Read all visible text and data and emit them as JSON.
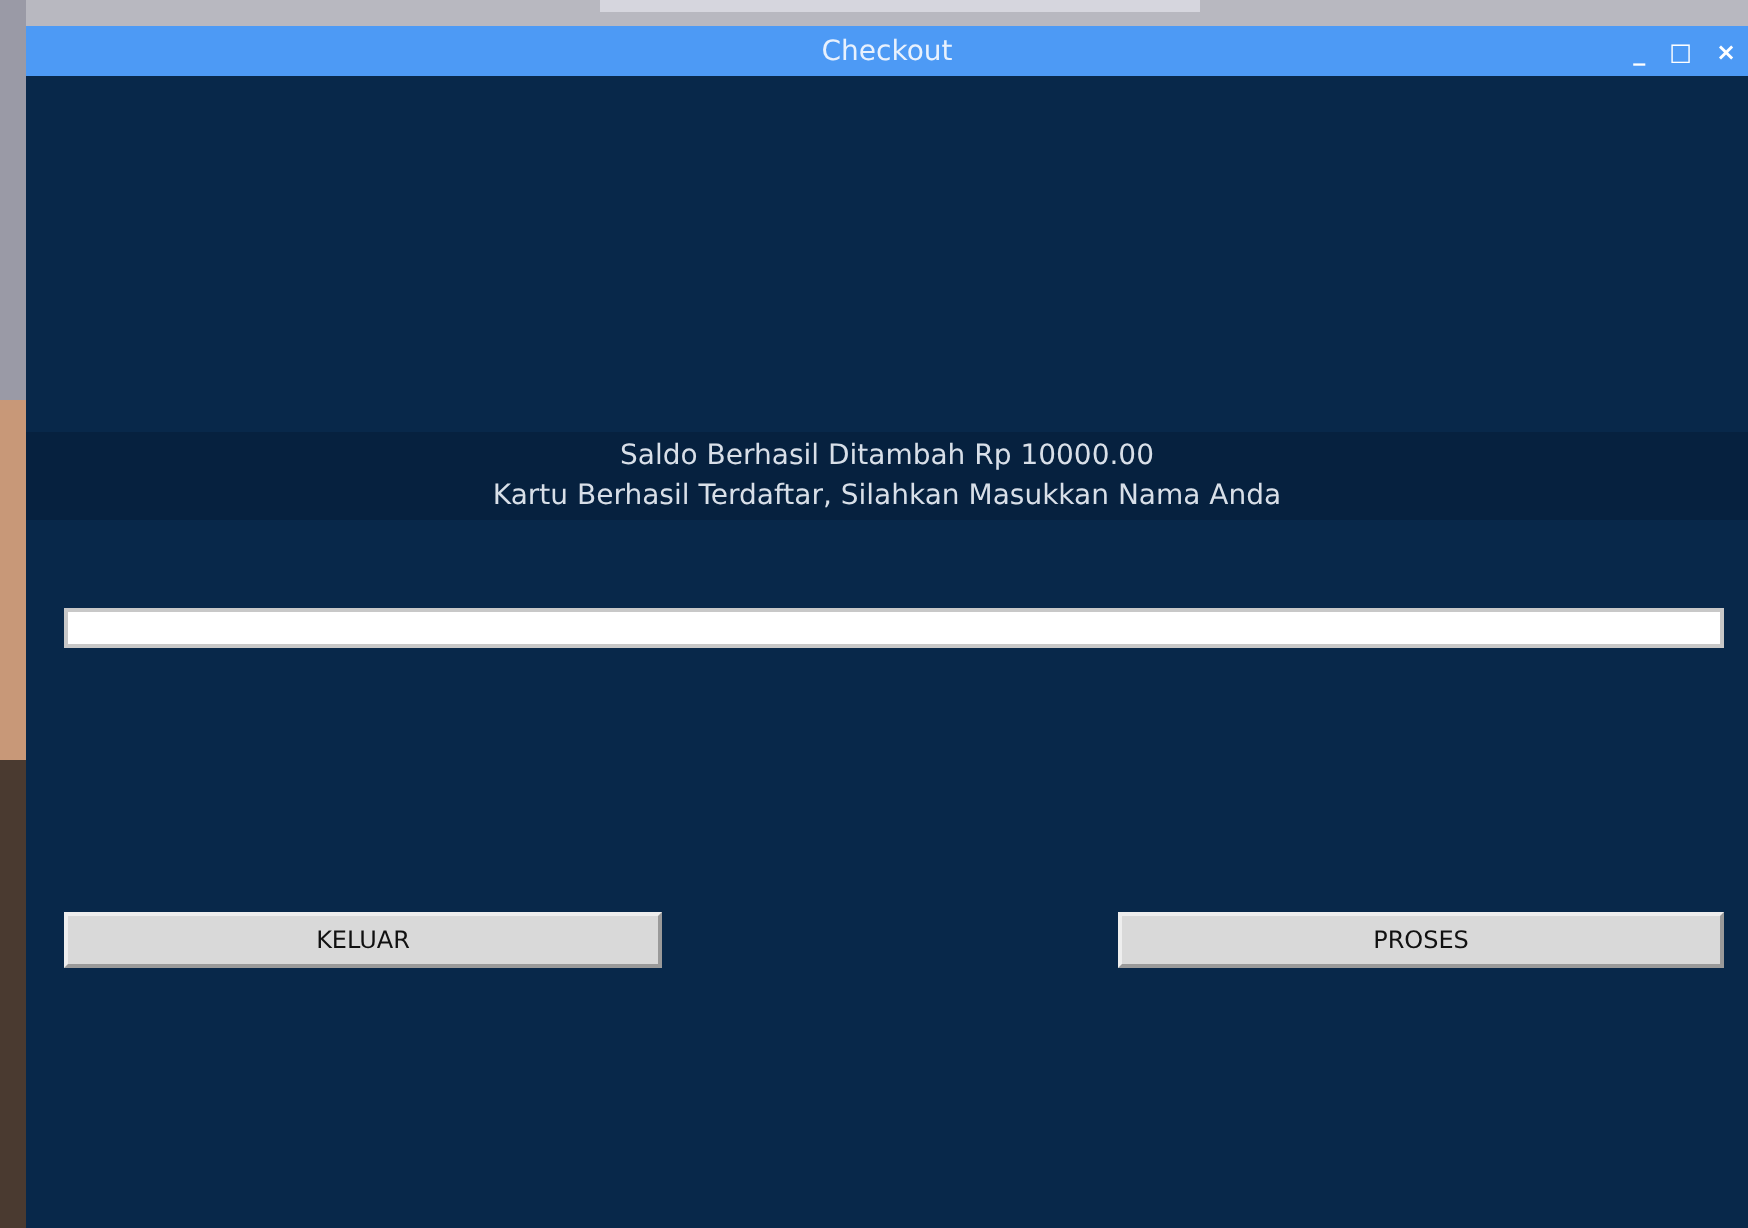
{
  "window": {
    "title": "Checkout",
    "controls": [
      "_",
      "□",
      "×"
    ]
  },
  "messages": [
    "Saldo Berhasil Ditambah Rp 10000.00",
    "Kartu Berhasil Terdaftar, Silahkan Masukkan Nama Anda"
  ],
  "buttons": [
    {
      "label": "KELUAR"
    },
    {
      "label": "PROSES"
    }
  ]
}
